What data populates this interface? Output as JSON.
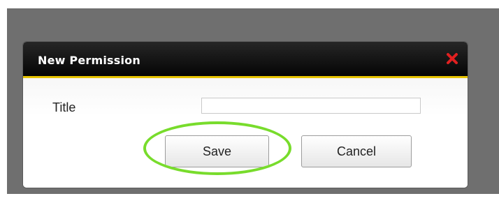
{
  "dialog": {
    "title": "New Permission",
    "close_icon": "close-x-icon",
    "title_field": {
      "label": "Title",
      "value": "",
      "placeholder": ""
    },
    "buttons": {
      "save_label": "Save",
      "cancel_label": "Cancel"
    }
  },
  "colors": {
    "titlebar": "#050505",
    "accent": "#e6c300",
    "close_icon": "#e02020",
    "highlight": "#78dc2c",
    "backdrop": "#6f6f6f"
  }
}
